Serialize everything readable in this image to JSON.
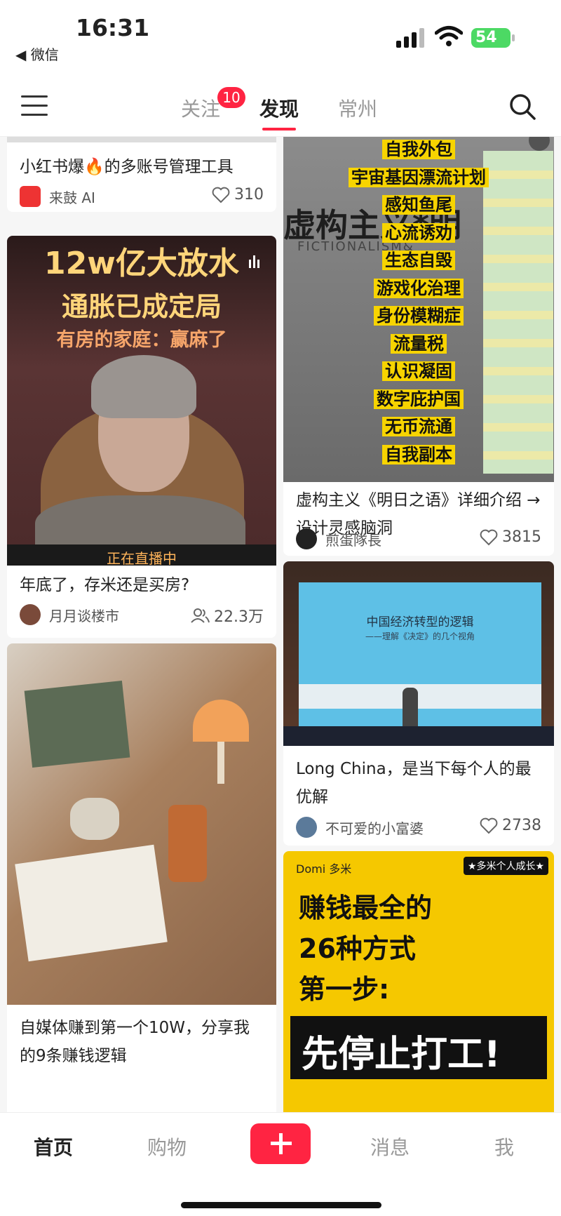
{
  "status": {
    "time": "16:31",
    "back_app": "◀ 微信",
    "battery": "54"
  },
  "nav": {
    "tabs": [
      "关注",
      "发现",
      "常州"
    ],
    "active": "发现",
    "badge": "10"
  },
  "feed": {
    "left": [
      {
        "title": "小红书爆🔥的多账号管理工具",
        "author": "来鼓 AI",
        "likes": "310"
      },
      {
        "title": "年底了，存米还是买房?",
        "author": "月月谈楼市",
        "viewers": "22.3万",
        "cover_lines": [
          "12w亿大放水",
          "通胀已成定局",
          "有房的家庭：赢麻了"
        ],
        "cover_bottom": "正在直播中"
      },
      {
        "title": "自媒体赚到第一个10W，分享我的9条赚钱逻辑"
      }
    ],
    "right": [
      {
        "title": "虚构主义《明日之语》详细介绍 → 设计灵感脑洞",
        "author": "煎蛋隊長",
        "likes": "3815",
        "cover_lines": [
          "自我外包",
          "宇宙基因漂流计划",
          "感知鱼尾",
          "心流诱劝",
          "生态自毁",
          "游戏化治理",
          "身份模糊症",
          "流量税",
          "认识凝固",
          "数字庇护国",
          "无币流通",
          "自我副本"
        ],
        "book_text": "虚构主义*明",
        "book_sub": "FICTIONALISM&"
      },
      {
        "title": "Long China，是当下每个人的最优解",
        "author": "不可爱的小富婆",
        "likes": "2738",
        "slide_title": "中国经济转型的逻辑",
        "slide_sub": "——理解《决定》的几个视角"
      },
      {
        "title_cover": [
          "赚钱最全的",
          "26种方式",
          "第一步:",
          "先停止打工!"
        ],
        "brand": "Domi 多米",
        "tag": "★多米个人成长★"
      }
    ]
  },
  "bottom": {
    "tabs": [
      "首页",
      "购物",
      "消息",
      "我"
    ],
    "active": "首页"
  },
  "colors": {
    "accent": "#ff2442",
    "yellow": "#f7d400"
  }
}
